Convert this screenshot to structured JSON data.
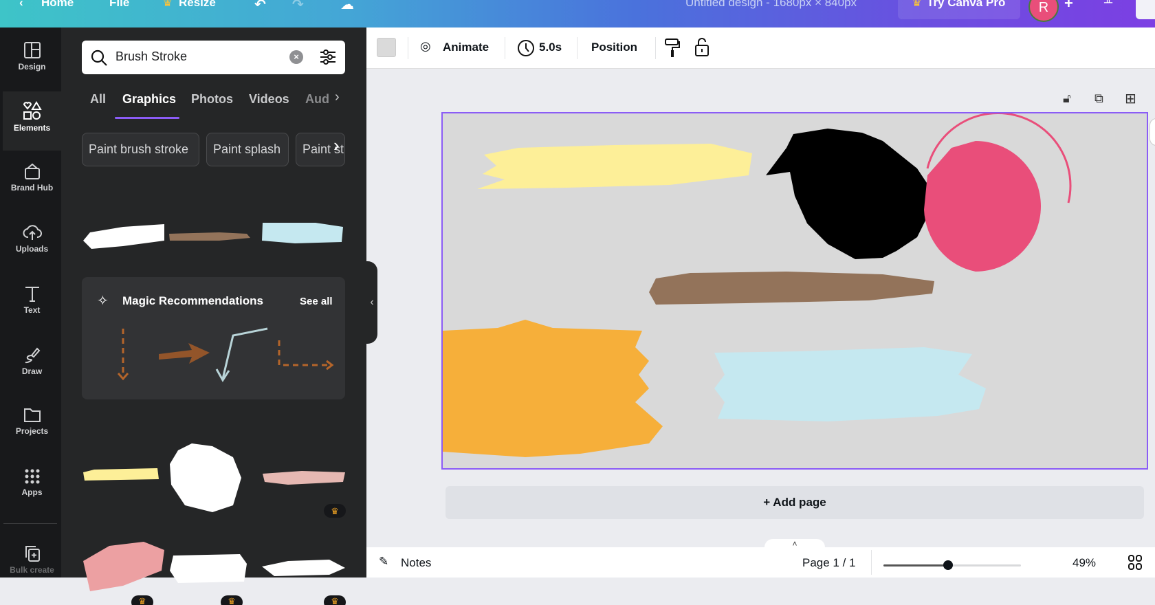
{
  "topbar": {
    "home": "Home",
    "file": "File",
    "resize": "Resize",
    "title": "Untitled design - 1680px × 840px",
    "try_pro": "Try Canva Pro",
    "avatar_initial": "R"
  },
  "rail": [
    {
      "label": "Design",
      "icon": "layout-icon"
    },
    {
      "label": "Elements",
      "icon": "shapes-icon"
    },
    {
      "label": "Brand Hub",
      "icon": "brand-icon"
    },
    {
      "label": "Uploads",
      "icon": "cloud-upload-icon"
    },
    {
      "label": "Text",
      "icon": "text-icon"
    },
    {
      "label": "Draw",
      "icon": "pen-icon"
    },
    {
      "label": "Projects",
      "icon": "folder-icon"
    },
    {
      "label": "Apps",
      "icon": "grid-icon"
    },
    {
      "label": "Bulk create",
      "icon": "bulk-create-icon"
    }
  ],
  "panel": {
    "search_value": "Brush Stroke",
    "tabs": [
      "All",
      "Graphics",
      "Photos",
      "Videos",
      "Audio"
    ],
    "active_tab": "Graphics",
    "chips": [
      "Paint brush stroke",
      "Paint splash",
      "Paint stroke"
    ],
    "magic_title": "Magic Recommendations",
    "see_all": "See all"
  },
  "toolbar": {
    "animate": "Animate",
    "duration": "5.0s",
    "position": "Position"
  },
  "canvas": {
    "add_page": "+ Add page",
    "page_border_color": "#8b5cf6",
    "colors": {
      "yellow": "#fdef98",
      "black": "#000000",
      "pink": "#e94e7a",
      "brown": "#93735a",
      "orange": "#f6af3a",
      "lightblue": "#c5e8f0"
    }
  },
  "bottombar": {
    "notes": "Notes",
    "page": "Page 1 / 1",
    "zoom": "49%",
    "zoom_value": 49
  }
}
